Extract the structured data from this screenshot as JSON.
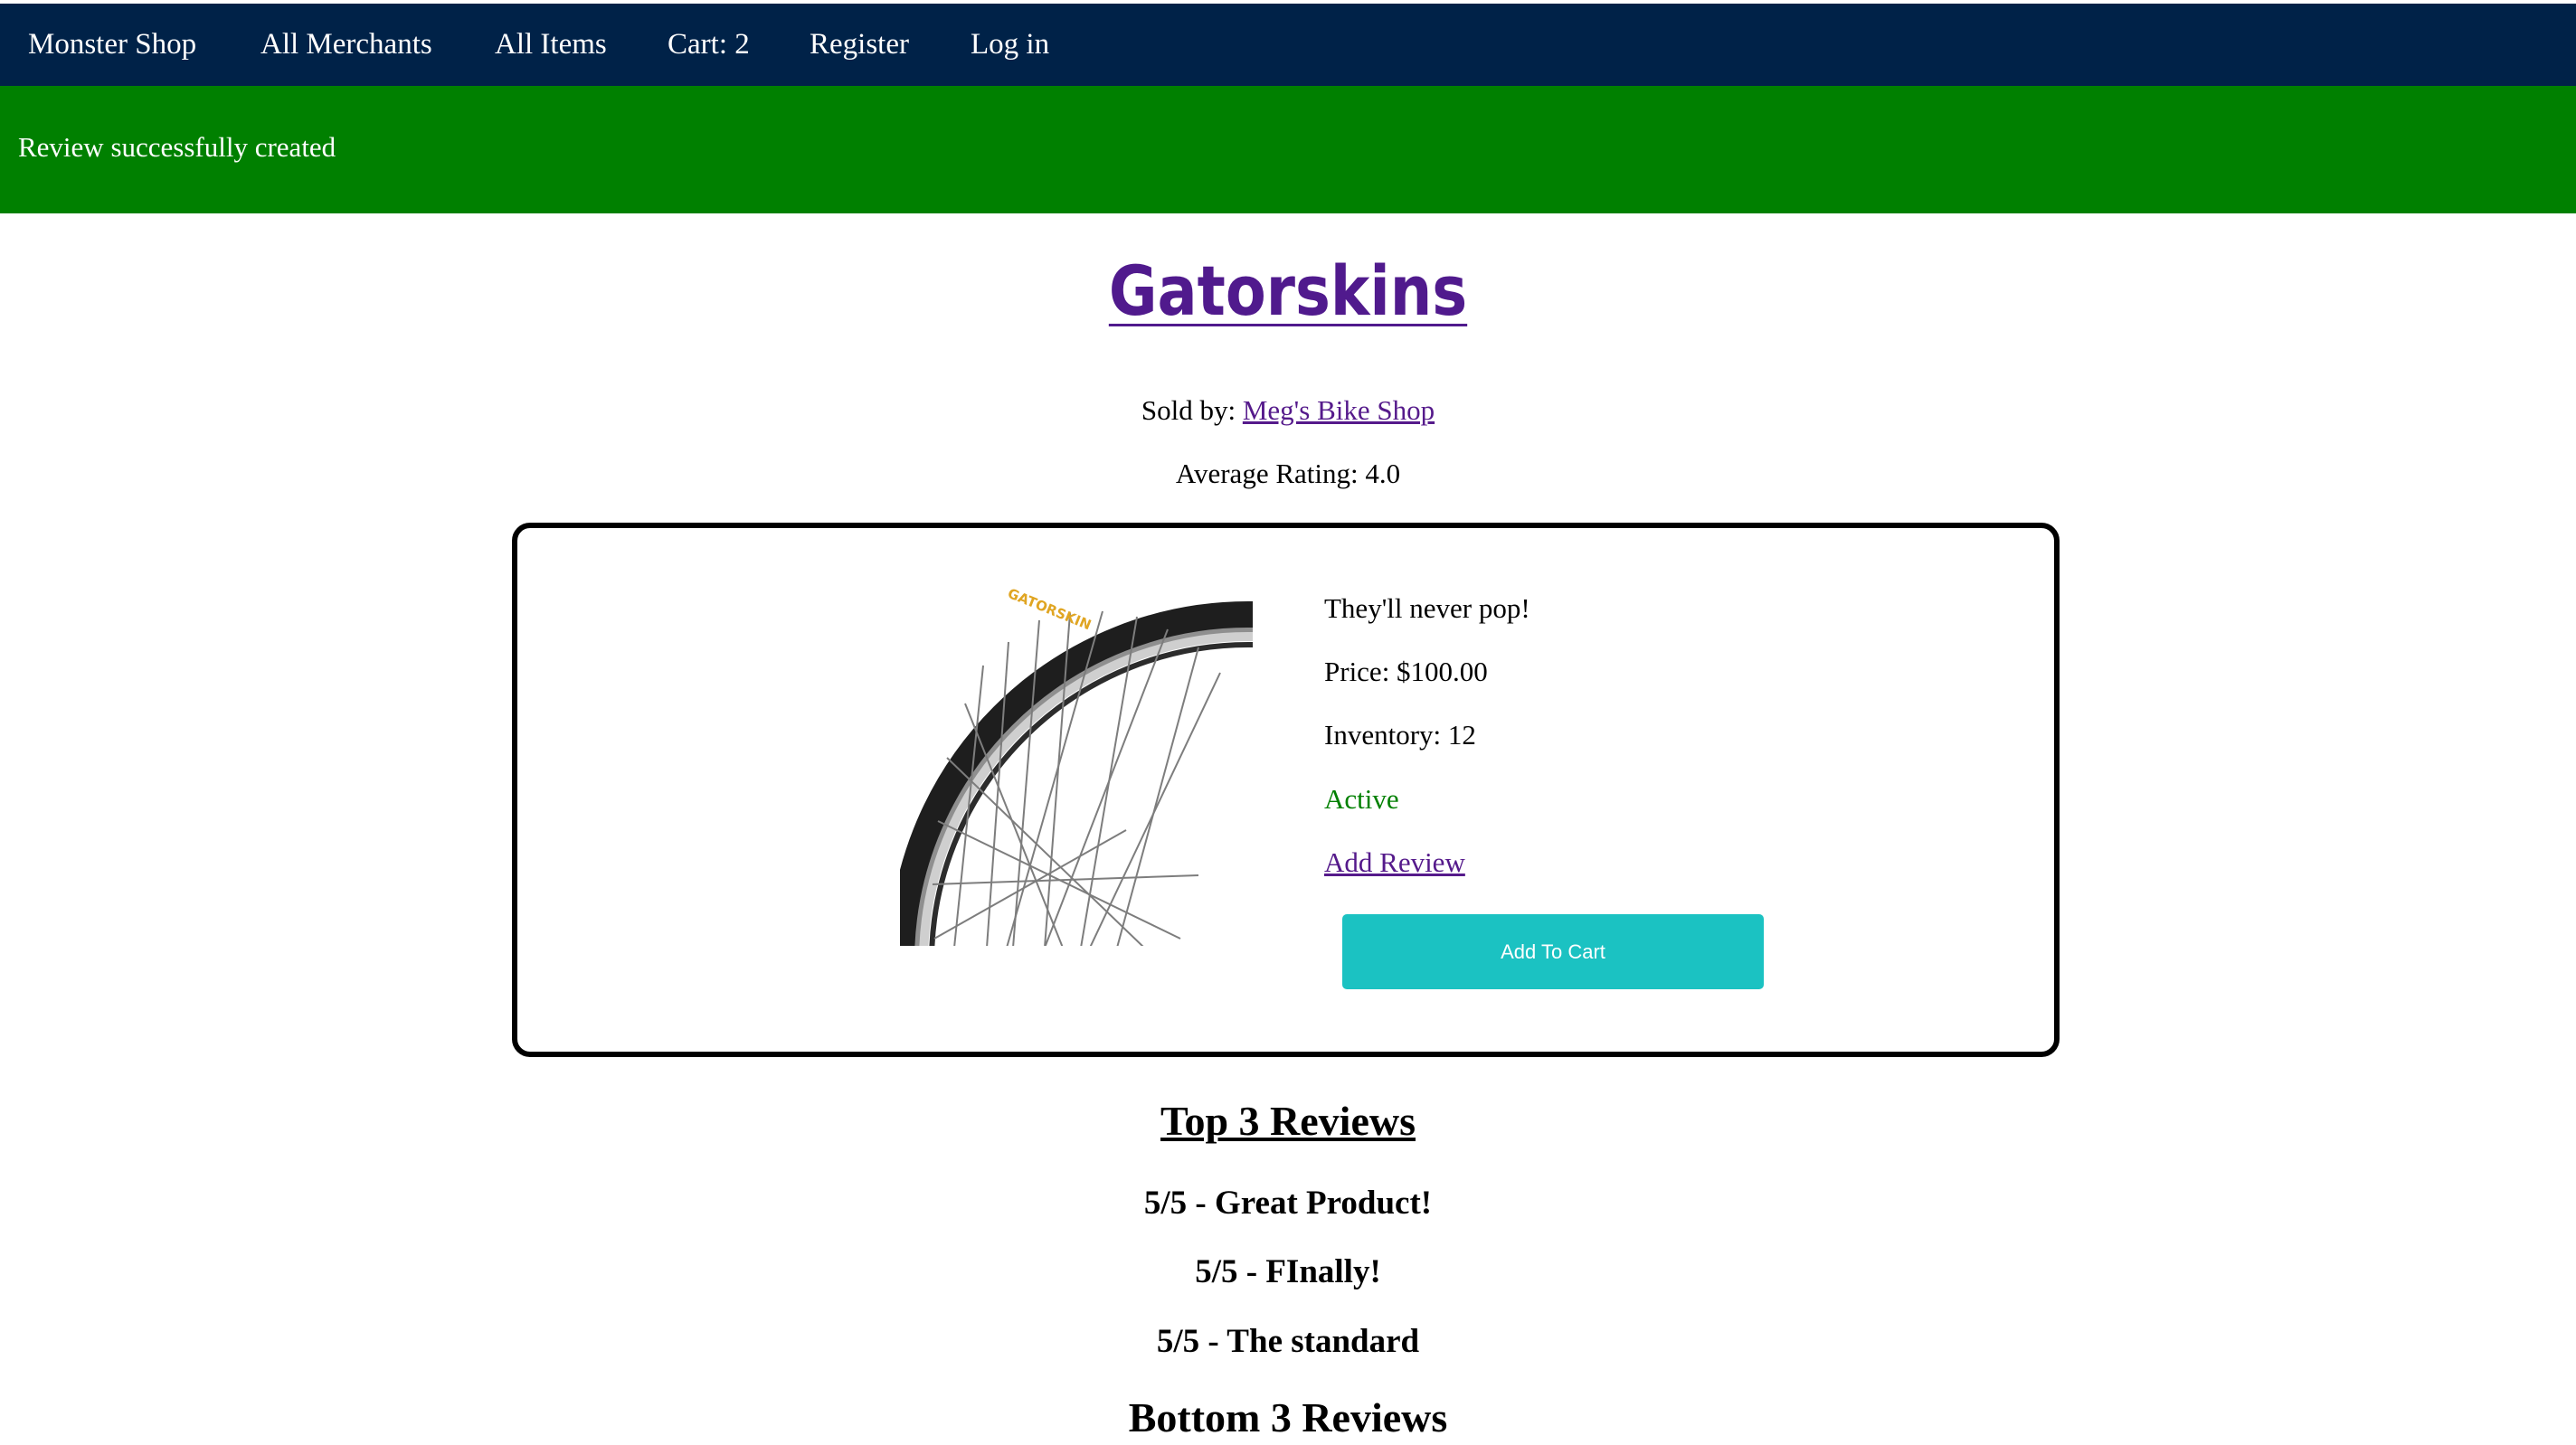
{
  "nav": {
    "items": [
      {
        "label": "Monster Shop"
      },
      {
        "label": "All Merchants"
      },
      {
        "label": "All Items"
      },
      {
        "label": "Cart: 2"
      },
      {
        "label": "Register"
      },
      {
        "label": "Log in"
      }
    ]
  },
  "flash": {
    "message": "Review successfully created"
  },
  "item": {
    "name": "Gatorskins",
    "sold_by_label": "Sold by:",
    "merchant": "Meg's Bike Shop",
    "average_rating_label": "Average Rating: 4.0",
    "description": "They'll never pop!",
    "price_label": "Price: $100.00",
    "inventory_label": "Inventory: 12",
    "status": "Active",
    "add_review_label": "Add Review",
    "add_to_cart_label": "Add To Cart",
    "image_brand_text": "GATORSKIN"
  },
  "reviews": {
    "top_heading": "Top 3 Reviews",
    "top": [
      {
        "label": "5/5 - Great Product!"
      },
      {
        "label": "5/5 - FInally!"
      },
      {
        "label": "5/5 - The standard"
      }
    ],
    "bottom_heading": "Bottom 3 Reviews"
  }
}
